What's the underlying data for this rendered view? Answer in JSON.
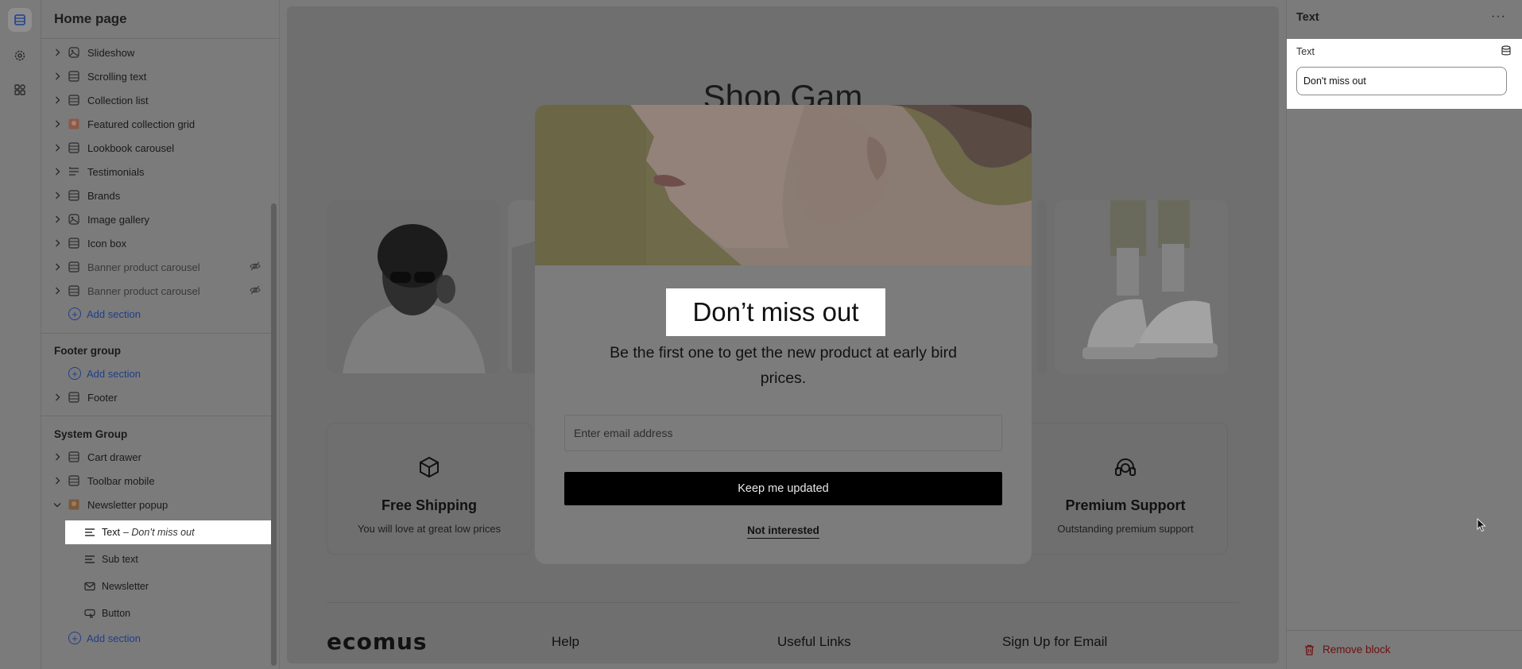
{
  "sidebar": {
    "title": "Home page",
    "template_items": [
      {
        "label": "Slideshow",
        "icon": "slideshow-icon",
        "hidden": false
      },
      {
        "label": "Scrolling text",
        "icon": "section-icon",
        "hidden": false
      },
      {
        "label": "Collection list",
        "icon": "section-icon",
        "hidden": false
      },
      {
        "label": "Featured collection grid",
        "icon": "image-thumb-icon",
        "hidden": false
      },
      {
        "label": "Lookbook carousel",
        "icon": "section-icon",
        "hidden": false
      },
      {
        "label": "Testimonials",
        "icon": "testimonials-icon",
        "hidden": false
      },
      {
        "label": "Brands",
        "icon": "section-icon",
        "hidden": false
      },
      {
        "label": "Image gallery",
        "icon": "image-gallery-icon",
        "hidden": false
      },
      {
        "label": "Icon box",
        "icon": "section-icon",
        "hidden": false
      },
      {
        "label": "Banner product carousel",
        "icon": "section-icon",
        "hidden": true
      },
      {
        "label": "Banner product carousel",
        "icon": "section-icon",
        "hidden": true
      }
    ],
    "add_section": "Add section",
    "footer_group": {
      "title": "Footer group",
      "add_section": "Add section",
      "items": [
        {
          "label": "Footer"
        }
      ]
    },
    "system_group": {
      "title": "System Group",
      "items": [
        {
          "label": "Cart drawer"
        },
        {
          "label": "Toolbar mobile"
        },
        {
          "label": "Newsletter popup"
        }
      ],
      "blocks": [
        {
          "label": "Text",
          "suffix": "– Don’t miss out",
          "icon": "text-lines-icon"
        },
        {
          "label": "Sub text",
          "icon": "text-lines-icon"
        },
        {
          "label": "Newsletter",
          "icon": "mail-icon"
        },
        {
          "label": "Button",
          "icon": "button-icon"
        }
      ],
      "add_section": "Add section"
    }
  },
  "preview": {
    "shop_title": "Shop Gam",
    "features": [
      {
        "title": "Free Shipping",
        "subtitle": "You will love at great low prices",
        "icon": "box-icon"
      },
      {
        "title": "Premium Support",
        "subtitle": "Outstanding premium support",
        "icon": "headset-icon"
      }
    ],
    "footer": {
      "logo": "ecomus",
      "headings": [
        "Help",
        "Useful Links",
        "Sign Up for Email"
      ]
    }
  },
  "modal": {
    "heading": "Don’t miss out",
    "subtext": "Be the first one to get the new product at early bird prices.",
    "email_placeholder": "Enter email address",
    "submit_label": "Keep me updated",
    "dismiss_label": "Not interested"
  },
  "right_panel": {
    "title": "Text",
    "more": "···",
    "field_label": "Text",
    "field_value": "Don't miss out",
    "remove_label": "Remove block"
  },
  "colors": {
    "accent_link": "#1f3e8a",
    "danger": "#6e0f0f",
    "overlay": "#7b7b7b"
  }
}
